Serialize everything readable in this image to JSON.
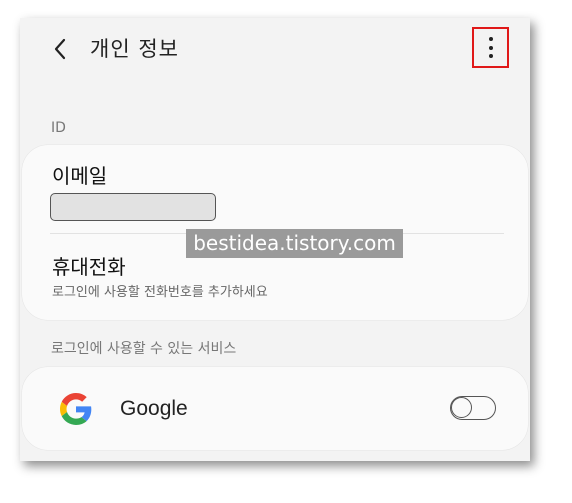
{
  "header": {
    "title": "개인 정보",
    "back_icon": "back-arrow-icon",
    "more_icon": "more-vertical-icon"
  },
  "id_section": {
    "label": "ID",
    "email": {
      "title": "이메일",
      "value_masked": true
    },
    "phone": {
      "title": "휴대전화",
      "subtitle": "로그인에 사용할 전화번호를 추가하세요"
    }
  },
  "watermark": "bestidea.tistory.com",
  "services_section": {
    "label": "로그인에 사용할 수 있는 서비스",
    "items": [
      {
        "name": "Google",
        "icon": "google-logo-icon",
        "enabled": false
      }
    ]
  },
  "colors": {
    "highlight_border": "#e01818",
    "background": "#f3f3f3",
    "card": "#fafafa"
  }
}
